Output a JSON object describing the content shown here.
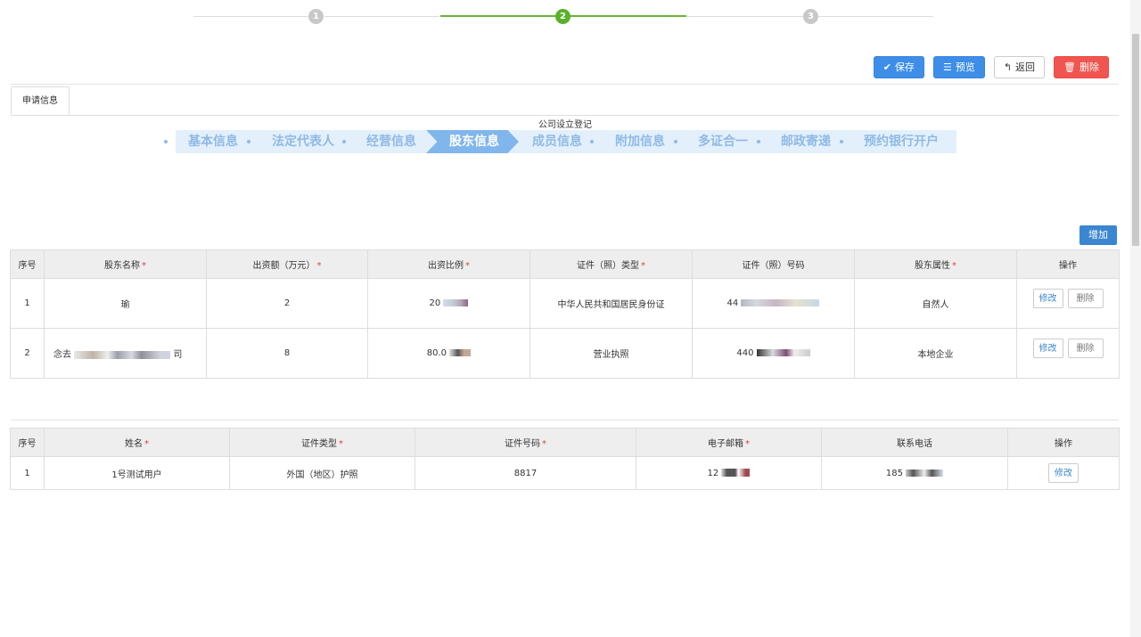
{
  "stepper": {
    "steps": [
      "1",
      "2",
      "3"
    ],
    "current": 2
  },
  "toolbar": {
    "save": "保存",
    "preview": "预览",
    "back": "返回",
    "delete": "删除"
  },
  "tab": {
    "label": "申请信息"
  },
  "form_title": "公司设立登记",
  "substeps": [
    "基本信息",
    "法定代表人",
    "经营信息",
    "股东信息",
    "成员信息",
    "附加信息",
    "多证合一",
    "邮政寄递",
    "预约银行开户"
  ],
  "shareholders": {
    "add_button": "增加",
    "headers": [
      "序号",
      "股东名称",
      "出资额（万元）",
      "出资比例",
      "证件（照）类型",
      "证件（照）号码",
      "股东属性",
      "操作"
    ],
    "required": [
      false,
      true,
      true,
      true,
      true,
      false,
      true,
      false
    ],
    "rows": [
      {
        "no": "1",
        "name": "瑜",
        "amount": "2",
        "ratio": "20",
        "id_type": "中华人民共和国居民身份证",
        "id_no": "44",
        "attr": "自然人"
      },
      {
        "no": "2",
        "name": "念去",
        "name_tail": "司",
        "amount": "8",
        "ratio": "80.0",
        "id_type": "营业执照",
        "id_no": "440",
        "attr": "本地企业"
      }
    ],
    "edit": "修改",
    "remove": "删除"
  },
  "members": {
    "headers": [
      "序号",
      "姓名",
      "证件类型",
      "证件号码",
      "电子邮箱",
      "联系电话",
      "操作"
    ],
    "required": [
      false,
      true,
      true,
      true,
      true,
      false,
      false
    ],
    "rows": [
      {
        "no": "1",
        "name": "1号测试用户",
        "id_type": "外国（地区）护照",
        "id_no": "8817",
        "email": "12",
        "phone": "185"
      }
    ],
    "edit": "修改"
  },
  "colors": {
    "accent": "#3e8ee8",
    "danger": "#f0564f",
    "step_active": "#5bb02b",
    "substep_active": "#80b6ec",
    "substep_bg": "#e3f0fb"
  }
}
